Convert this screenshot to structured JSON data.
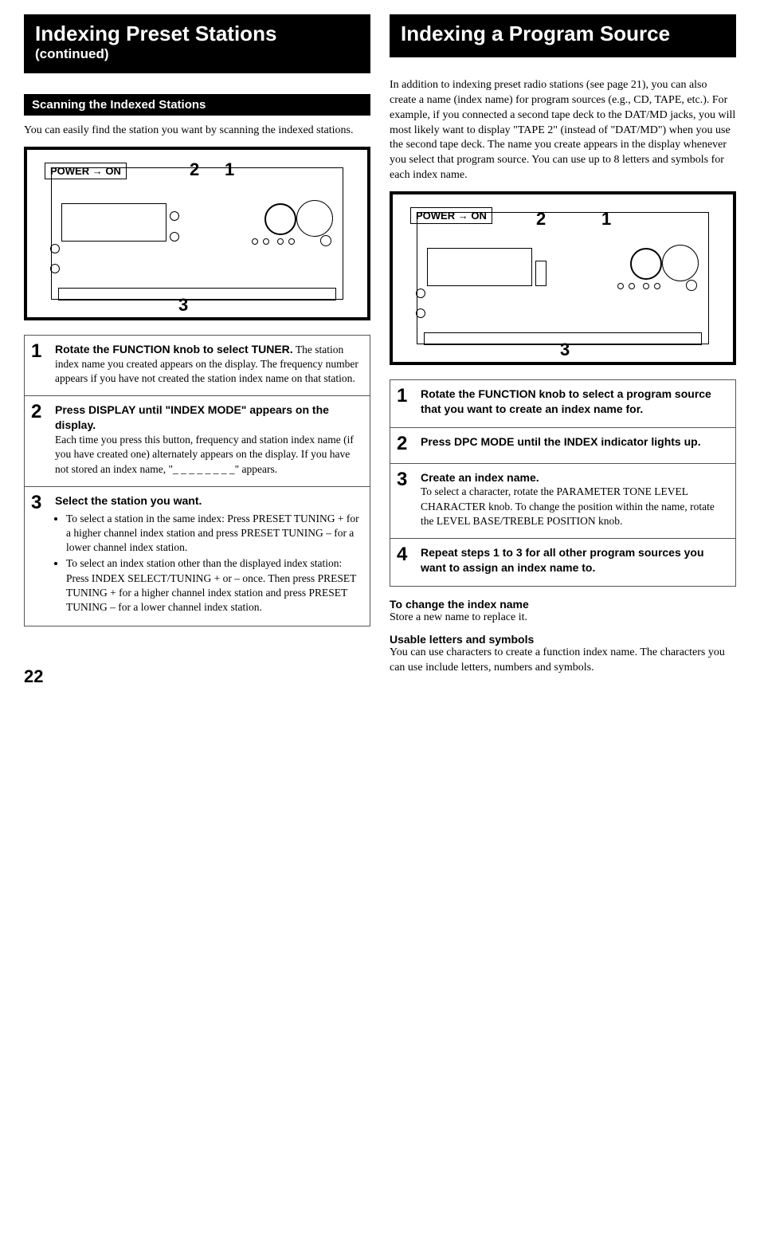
{
  "page_number": "22",
  "left": {
    "title_main": "Indexing Preset Stations",
    "title_sub": "(continued)",
    "subheader": "Scanning the Indexed Stations",
    "intro": "You can easily find the station you want by scanning the indexed stations.",
    "diag": {
      "power": "POWER → ON",
      "n1": "1",
      "n2": "2",
      "n3": "3"
    },
    "steps": [
      {
        "num": "1",
        "lead": "Rotate the FUNCTION knob to select TUNER.",
        "body": "The station index name you created appears on the display. The frequency number appears if you have not created the station index name on that station."
      },
      {
        "num": "2",
        "lead": "Press DISPLAY until \"INDEX MODE\" appears on the display.",
        "body": "Each time you press this button, frequency and station index name (if you have created one) alternately appears on the display. If you have not stored an index name, \"_ _ _ _ _ _ _ _\" appears."
      },
      {
        "num": "3",
        "lead": "Select the station you want.",
        "bullets": [
          "To select a station in the same index: Press PRESET TUNING + for a higher channel index station and press PRESET TUNING – for a lower channel index station.",
          "To select an index station other than the displayed index station: Press INDEX SELECT/TUNING + or – once. Then press PRESET TUNING + for a higher channel index station and press PRESET TUNING – for a lower channel index station."
        ]
      }
    ]
  },
  "right": {
    "title_main": "Indexing a Program Source",
    "intro": "In addition to indexing preset radio stations (see page 21), you can also create a name (index name) for program sources (e.g., CD, TAPE, etc.). For example, if you connected a second tape deck to the DAT/MD jacks, you will most likely want to display \"TAPE 2\" (instead of \"DAT/MD\") when you use the second tape deck. The name you create appears in the display whenever you select that program source. You can use up to 8 letters and symbols for each index name.",
    "diag": {
      "power": "POWER → ON",
      "n1": "1",
      "n2": "2",
      "n3": "3"
    },
    "steps": [
      {
        "num": "1",
        "lead": "Rotate the FUNCTION knob to select a program source that you want to create an index name for."
      },
      {
        "num": "2",
        "lead": "Press DPC MODE until the INDEX indicator lights up."
      },
      {
        "num": "3",
        "lead": "Create an index name.",
        "body": "To select a character, rotate the PARAMETER TONE LEVEL CHARACTER knob. To change the position within the name, rotate the LEVEL BASE/TREBLE POSITION knob."
      },
      {
        "num": "4",
        "lead": "Repeat steps 1 to 3 for all other program sources you want to assign an index name to."
      }
    ],
    "note1_head": "To change the index name",
    "note1_body": "Store a new name to replace it.",
    "note2_head": "Usable letters and symbols",
    "note2_body": "You can use characters to create a function index name. The characters you can use include letters, numbers and symbols."
  }
}
